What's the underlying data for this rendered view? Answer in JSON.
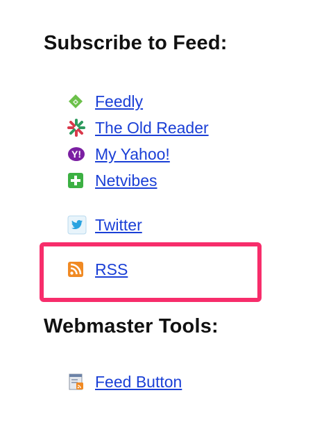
{
  "subscribe": {
    "heading": "Subscribe to Feed:",
    "items": [
      {
        "label": "Feedly",
        "icon": "feedly-icon"
      },
      {
        "label": "The Old Reader",
        "icon": "old-reader-icon"
      },
      {
        "label": "My Yahoo!",
        "icon": "yahoo-icon"
      },
      {
        "label": "Netvibes",
        "icon": "netvibes-icon"
      },
      {
        "label": "Twitter",
        "icon": "twitter-icon"
      },
      {
        "label": "RSS",
        "icon": "rss-icon"
      }
    ]
  },
  "webmaster": {
    "heading": "Webmaster Tools:",
    "items": [
      {
        "label": "Feed Button",
        "icon": "feed-button-icon"
      }
    ]
  },
  "colors": {
    "link": "#1a3fd6",
    "highlight": "#f72d6b",
    "heading": "#111111"
  }
}
